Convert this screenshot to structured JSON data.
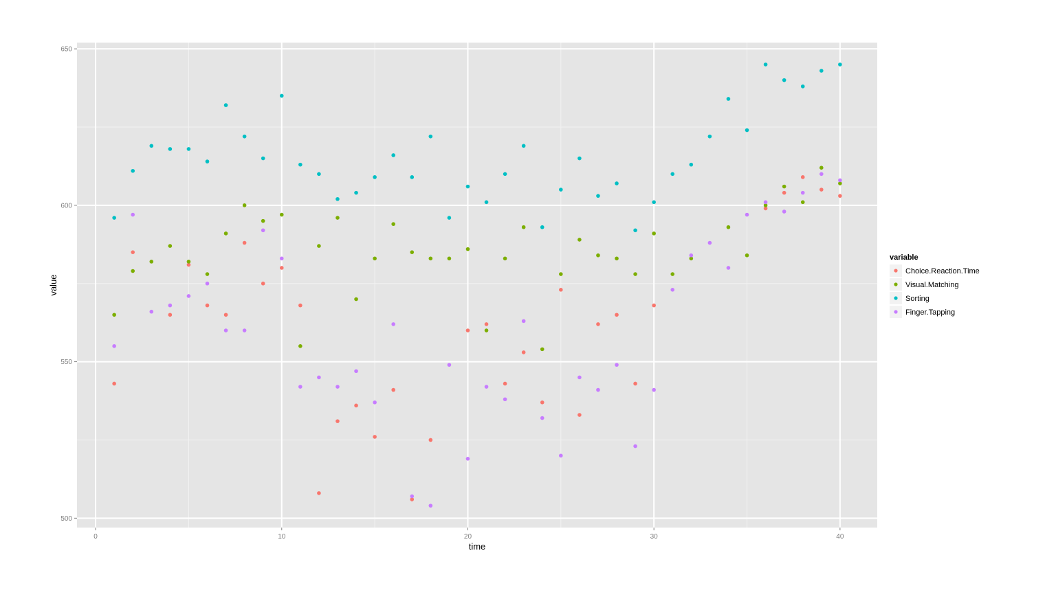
{
  "chart_data": {
    "type": "scatter",
    "title": "",
    "xlabel": "time",
    "ylabel": "value",
    "xlim": [
      -1,
      42
    ],
    "ylim": [
      497,
      652
    ],
    "xticks": [
      0,
      10,
      20,
      30,
      40
    ],
    "yticks": [
      500,
      550,
      600,
      650
    ],
    "grid": true,
    "legend": {
      "title": "variable",
      "position": "right"
    },
    "x": [
      1,
      2,
      3,
      4,
      5,
      6,
      7,
      8,
      9,
      10,
      11,
      12,
      13,
      14,
      15,
      16,
      17,
      18,
      19,
      20,
      21,
      22,
      23,
      24,
      25,
      26,
      27,
      28,
      29,
      30,
      31,
      32,
      33,
      34,
      35,
      36,
      37,
      38,
      39,
      40
    ],
    "series": [
      {
        "name": "Choice.Reaction.Time",
        "color": "#F8766D",
        "values": [
          543,
          585,
          null,
          565,
          581,
          568,
          565,
          588,
          575,
          580,
          568,
          508,
          531,
          536,
          526,
          541,
          506,
          525,
          null,
          560,
          562,
          543,
          553,
          537,
          573,
          533,
          562,
          565,
          543,
          568,
          null,
          null,
          null,
          null,
          null,
          599,
          604,
          609,
          605,
          603
        ]
      },
      {
        "name": "Visual.Matching",
        "color": "#7CAE00",
        "values": [
          565,
          579,
          582,
          587,
          582,
          578,
          591,
          600,
          595,
          597,
          555,
          587,
          596,
          570,
          583,
          594,
          585,
          583,
          583,
          586,
          560,
          583,
          593,
          554,
          578,
          589,
          584,
          583,
          578,
          591,
          578,
          583,
          null,
          593,
          584,
          600,
          606,
          601,
          612,
          607
        ]
      },
      {
        "name": "Sorting",
        "color": "#00BFC4",
        "values": [
          596,
          611,
          619,
          618,
          618,
          614,
          632,
          622,
          615,
          635,
          613,
          610,
          602,
          604,
          609,
          616,
          609,
          622,
          596,
          606,
          601,
          610,
          619,
          593,
          605,
          615,
          603,
          607,
          592,
          601,
          610,
          613,
          622,
          634,
          624,
          645,
          640,
          638,
          643,
          645
        ]
      },
      {
        "name": "Finger.Tapping",
        "color": "#C77CFF",
        "values": [
          555,
          597,
          566,
          568,
          571,
          575,
          560,
          560,
          592,
          583,
          542,
          545,
          542,
          547,
          537,
          562,
          507,
          504,
          549,
          519,
          542,
          538,
          563,
          532,
          520,
          545,
          541,
          549,
          523,
          541,
          573,
          584,
          588,
          580,
          597,
          601,
          598,
          604,
          610,
          608
        ]
      }
    ]
  }
}
